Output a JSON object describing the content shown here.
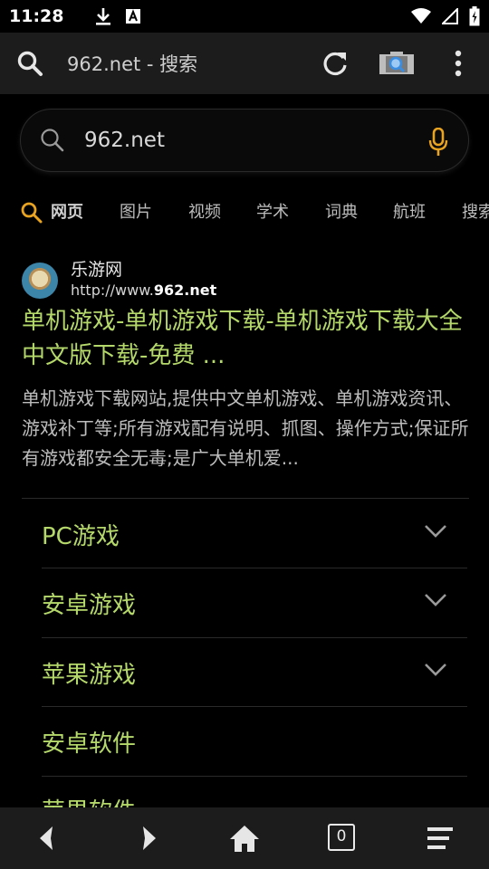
{
  "status_bar": {
    "time": "11:28"
  },
  "app_bar": {
    "title": "962.net - 搜索"
  },
  "search": {
    "query": "962.net"
  },
  "tabs": [
    {
      "label": "网页",
      "active": true
    },
    {
      "label": "图片"
    },
    {
      "label": "视频"
    },
    {
      "label": "学术"
    },
    {
      "label": "词典"
    },
    {
      "label": "航班"
    },
    {
      "label": "搜索"
    }
  ],
  "result": {
    "site_name": "乐游网",
    "url_prefix": "http://www.",
    "url_bold": "962.net",
    "title": "单机游戏-单机游戏下载-单机游戏下载大全中文版下载-免费 ...",
    "description": "单机游戏下载网站,提供中文单机游戏、单机游戏资讯、游戏补丁等;所有游戏配有说明、抓图、操作方式;保证所有游戏都安全无毒;是广大单机爱..."
  },
  "sub_links": [
    {
      "label": "PC游戏",
      "expandable": true
    },
    {
      "label": "安卓游戏",
      "expandable": true
    },
    {
      "label": "苹果游戏",
      "expandable": true
    },
    {
      "label": "安卓软件",
      "expandable": false
    },
    {
      "label": "苹果软件",
      "expandable": false
    }
  ],
  "bottom_nav": {
    "tab_count": "0"
  },
  "colors": {
    "link_green": "#b5d86a",
    "accent_orange": "#e8a321",
    "bar_bg": "#1c1c1c"
  }
}
